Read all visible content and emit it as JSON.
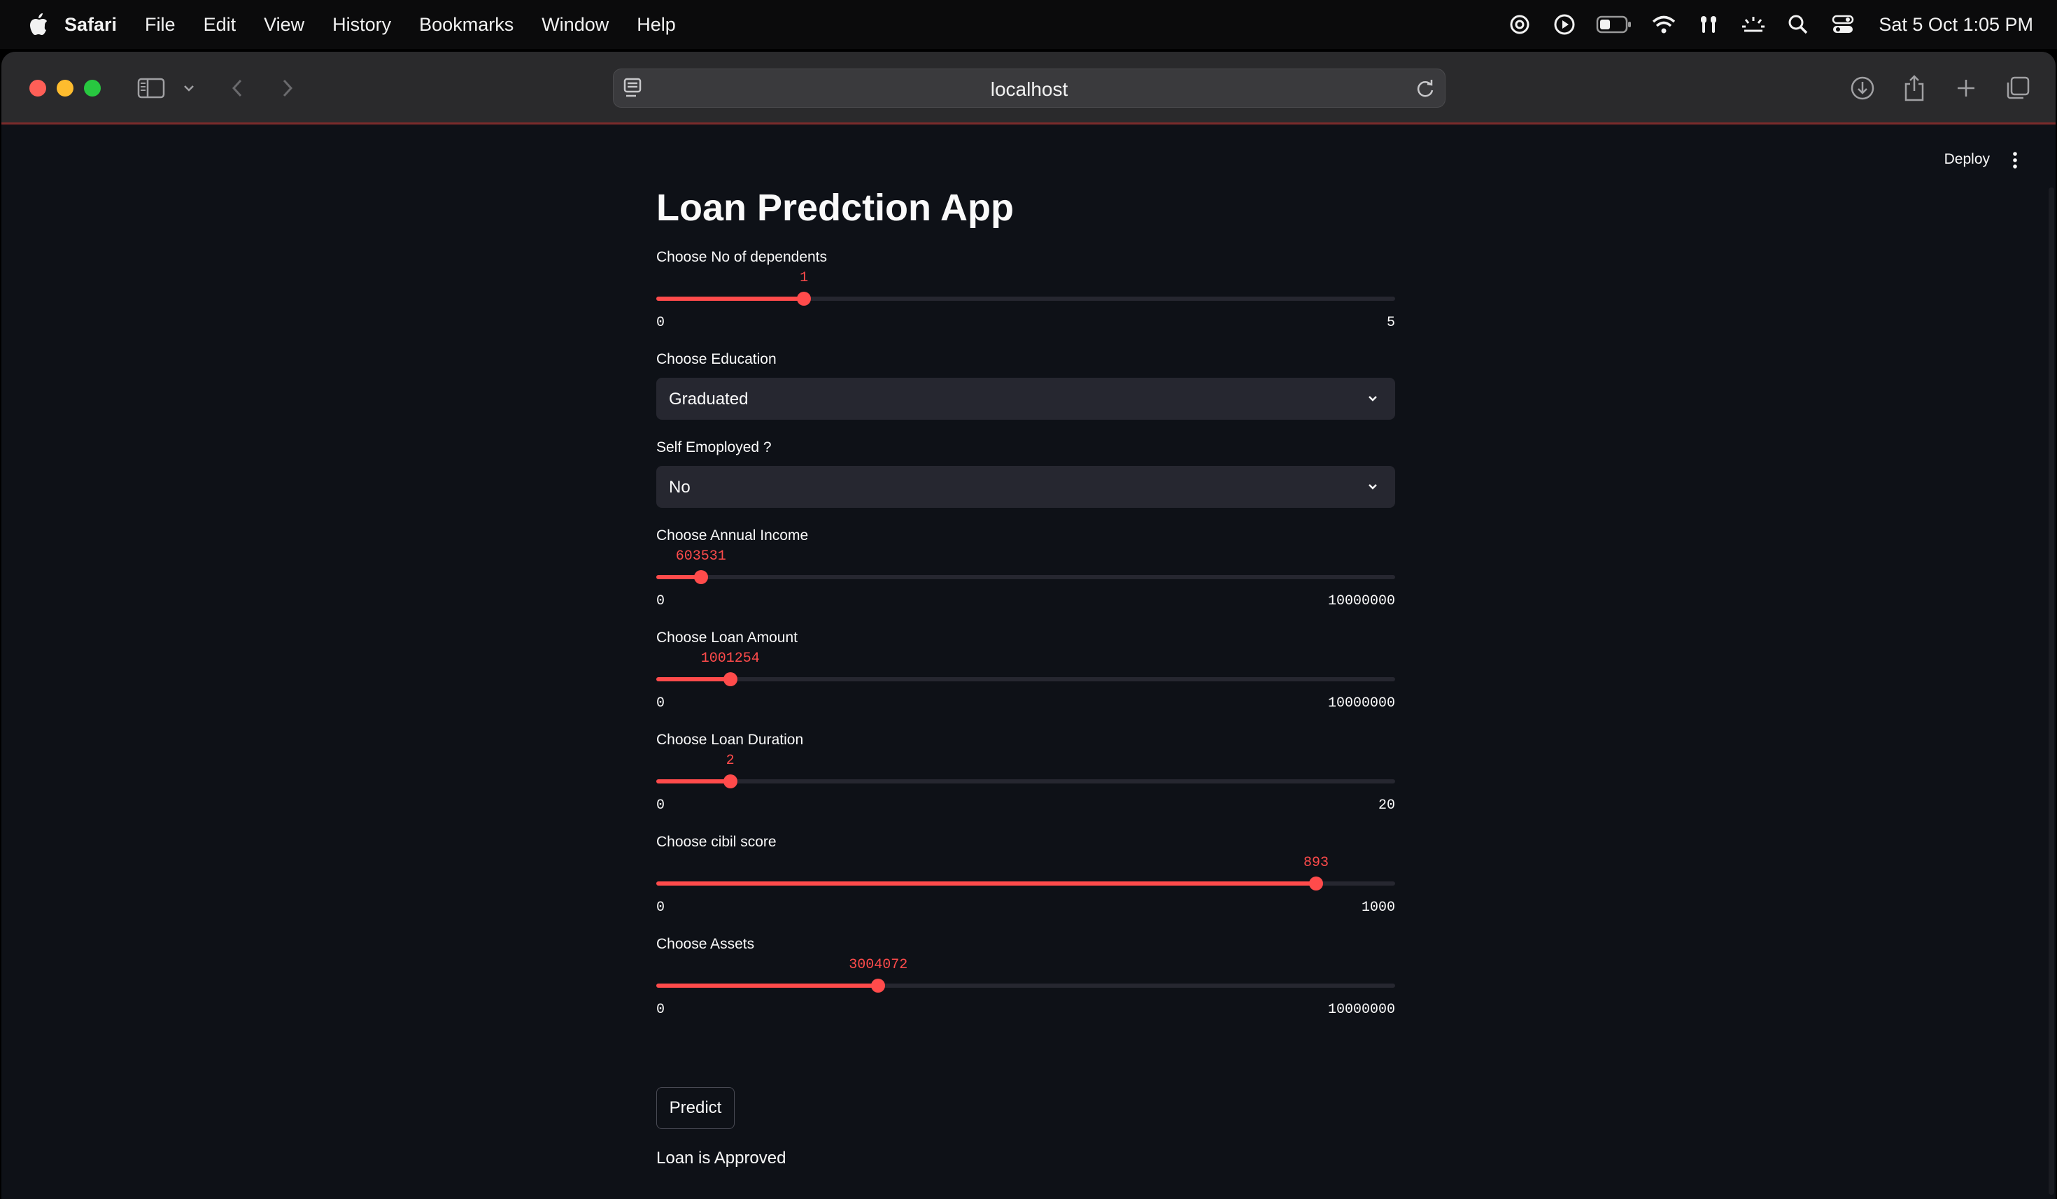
{
  "menubar": {
    "app_name": "Safari",
    "items": [
      "File",
      "Edit",
      "View",
      "History",
      "Bookmarks",
      "Window",
      "Help"
    ],
    "clock": "Sat 5 Oct  1:05 PM"
  },
  "browser": {
    "url": "localhost"
  },
  "app": {
    "deploy_label": "Deploy",
    "title": "Loan Predction App",
    "dependents": {
      "label": "Choose No of dependents",
      "value": "1",
      "min": "0",
      "max": "5",
      "fraction": 0.2
    },
    "education": {
      "label": "Choose Education",
      "selected": "Graduated"
    },
    "self_employed": {
      "label": "Self Emoployed ?",
      "selected": "No"
    },
    "annual_income": {
      "label": "Choose Annual Income",
      "value": "603531",
      "min": "0",
      "max": "10000000",
      "fraction": 0.0603531
    },
    "loan_amount": {
      "label": "Choose Loan Amount",
      "value": "1001254",
      "min": "0",
      "max": "10000000",
      "fraction": 0.1001254
    },
    "loan_duration": {
      "label": "Choose Loan Duration",
      "value": "2",
      "min": "0",
      "max": "20",
      "fraction": 0.1
    },
    "cibil": {
      "label": "Choose cibil score",
      "value": "893",
      "min": "0",
      "max": "1000",
      "fraction": 0.893
    },
    "assets": {
      "label": "Choose Assets",
      "value": "3004072",
      "min": "0",
      "max": "10000000",
      "fraction": 0.3004072
    },
    "predict_label": "Predict",
    "result": "Loan is Approved"
  },
  "colors": {
    "accent": "#ff4b4b",
    "background": "#0e1117",
    "widget": "#262730"
  }
}
